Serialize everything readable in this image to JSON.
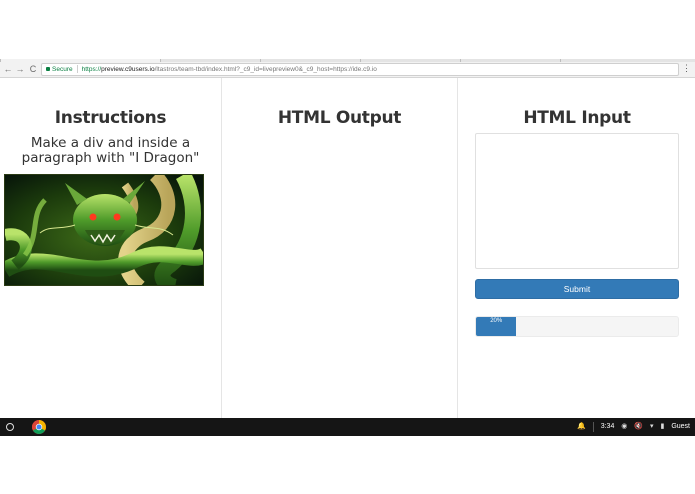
{
  "browser": {
    "secure_label": "Secure",
    "url_scheme": "https://",
    "url_host": "preview.c9users.io",
    "url_path": "/ltastros/team-tbd/index.html?_c9_id=livepreview0&_c9_host=https://ide.c9.io",
    "back_icon": "←",
    "forward_icon": "→",
    "reload_icon": "C",
    "menu_icon": "⋮"
  },
  "instructions": {
    "heading": "Instructions",
    "text": "Make a div and inside a paragraph with \"I Dragon\"",
    "image_icon": "dragon-image"
  },
  "output": {
    "heading": "HTML Output"
  },
  "input": {
    "heading": "HTML Input",
    "textarea_value": "",
    "submit_label": "Submit",
    "progress_label": "20%",
    "progress_value": 0.2
  },
  "taskbar": {
    "time": "3:34",
    "user": "Guest"
  },
  "colors": {
    "primary": "#337ab7",
    "secure": "#0b8043",
    "taskbar": "#151515"
  }
}
